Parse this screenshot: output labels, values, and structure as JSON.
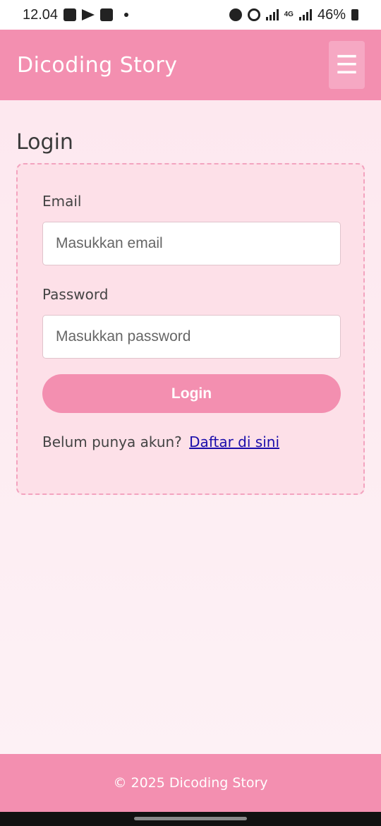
{
  "status_bar": {
    "time": "12.04",
    "network": "4G",
    "battery": "46%"
  },
  "header": {
    "brand": "Dicoding Story",
    "menu_icon": "hamburger-icon",
    "menu_glyph": "☰"
  },
  "main": {
    "title": "Login",
    "form": {
      "email_label": "Email",
      "email_placeholder": "Masukkan email",
      "password_label": "Password",
      "password_placeholder": "Masukkan password",
      "submit_label": "Login",
      "register_prompt": "Belum punya akun?",
      "register_link": "Daftar di sini"
    }
  },
  "footer": {
    "text": "© 2025 Dicoding Story"
  },
  "colors": {
    "primary": "#f38fb0",
    "background": "#fff0f4",
    "card": "#fde0e8",
    "link": "#1a0dab"
  }
}
